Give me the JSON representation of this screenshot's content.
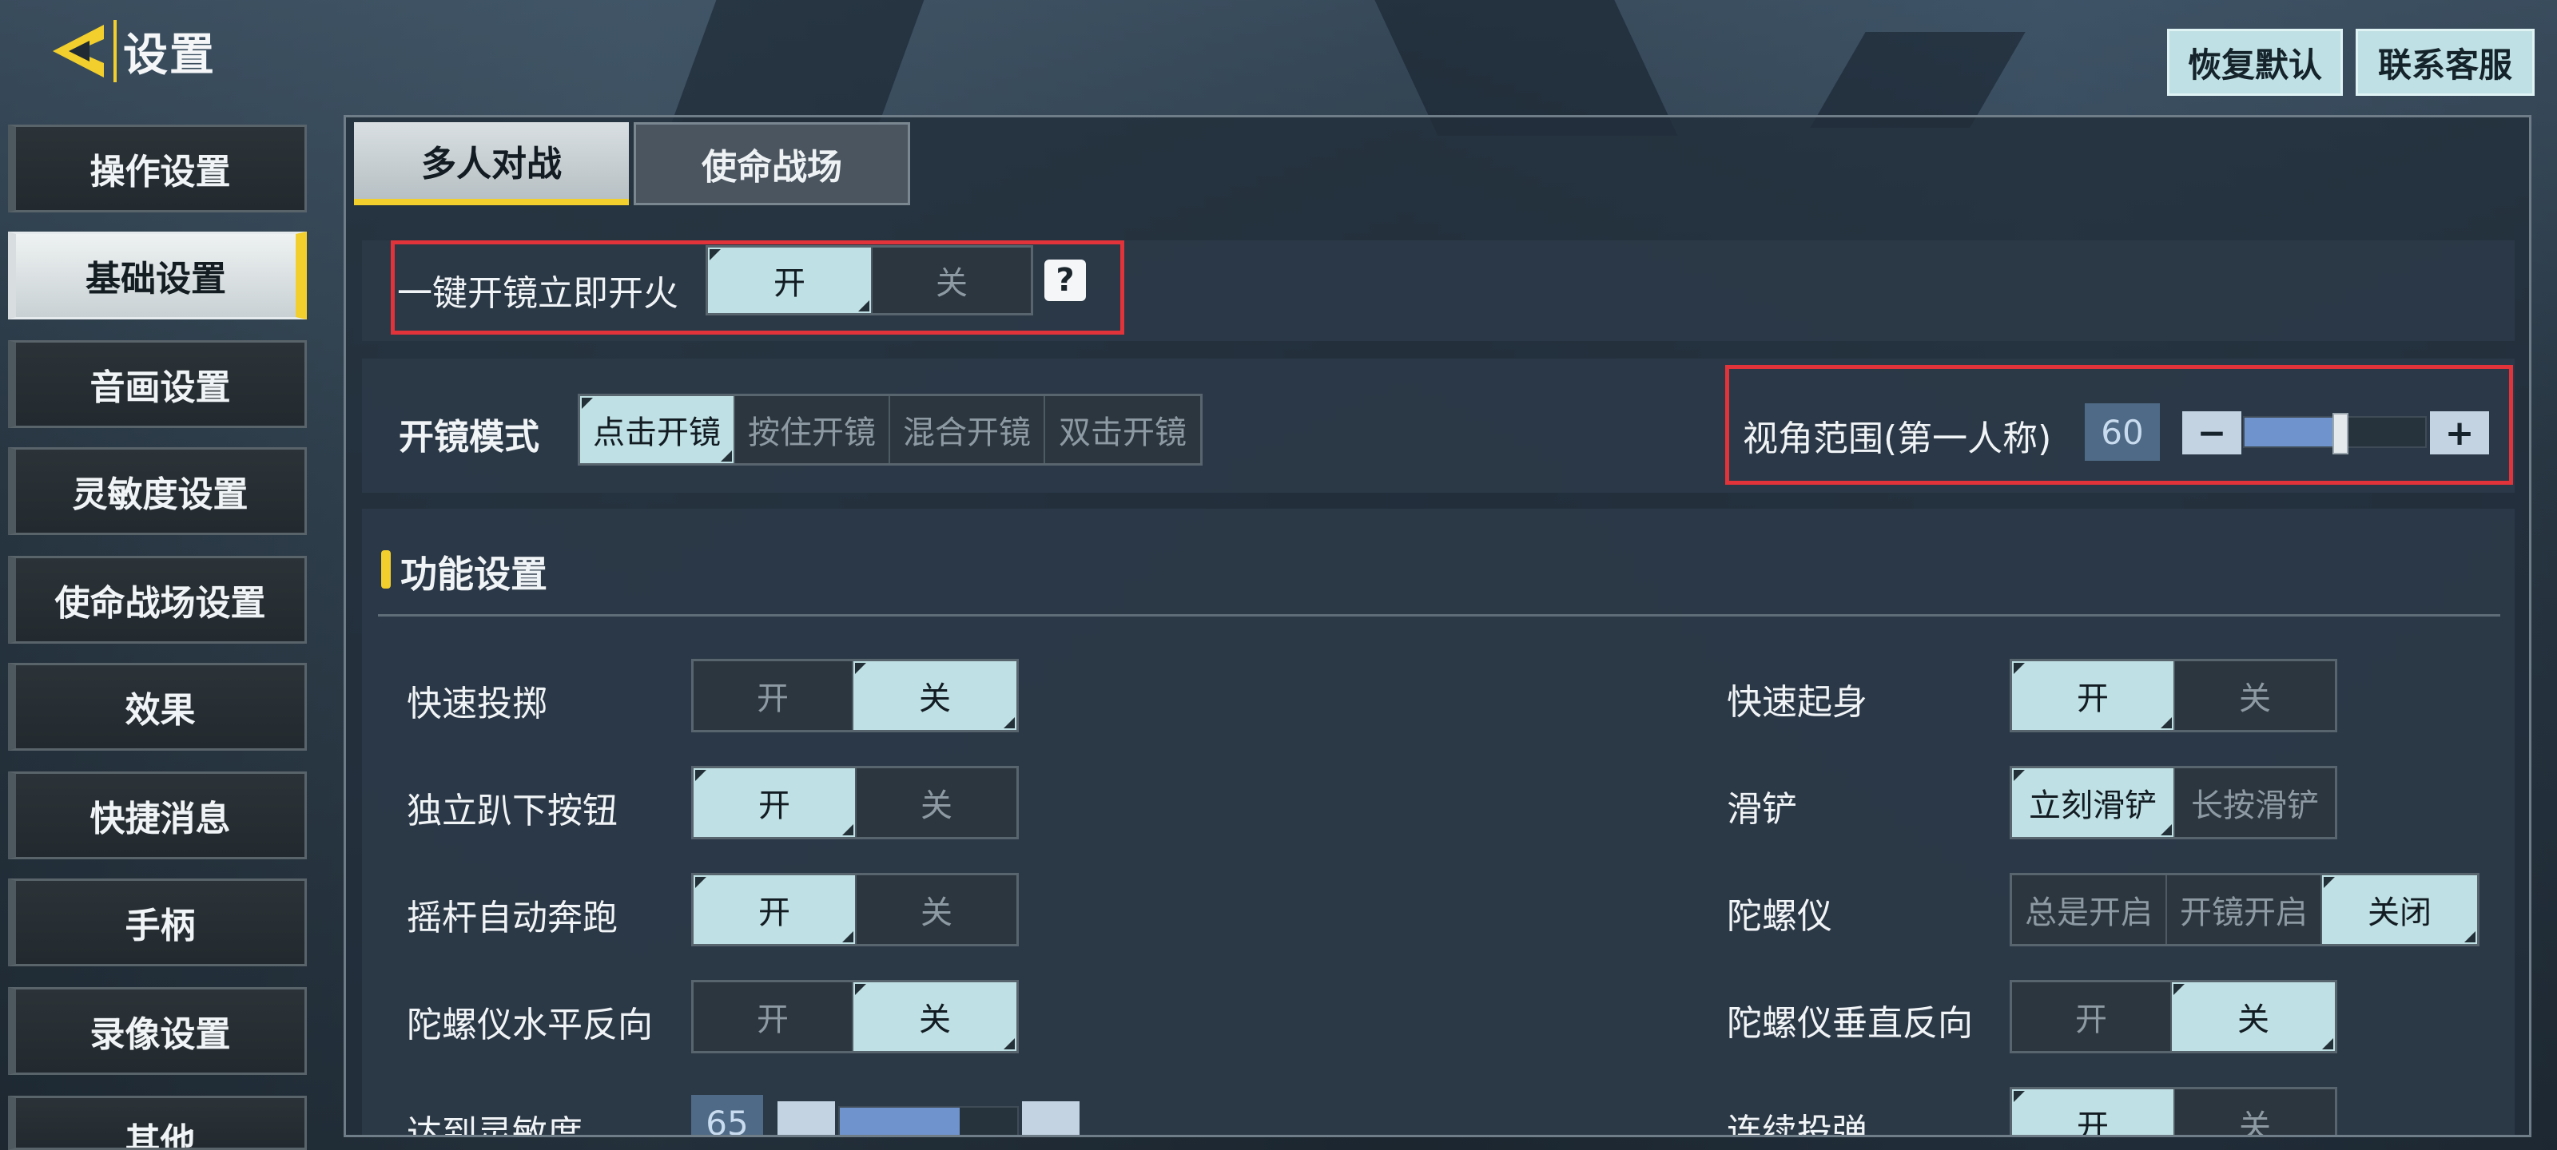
{
  "header": {
    "title": "设置",
    "restore_default": "恢复默认",
    "contact_support": "联系客服"
  },
  "sidebar": {
    "items": [
      {
        "label": "操作设置"
      },
      {
        "label": "基础设置",
        "active": true
      },
      {
        "label": "音画设置"
      },
      {
        "label": "灵敏度设置"
      },
      {
        "label": "使命战场设置"
      },
      {
        "label": "效果"
      },
      {
        "label": "快捷消息"
      },
      {
        "label": "手柄"
      },
      {
        "label": "录像设置"
      },
      {
        "label": "其他"
      }
    ]
  },
  "tabs": [
    {
      "label": "多人对战",
      "active": true
    },
    {
      "label": "使命战场",
      "active": false
    }
  ],
  "quick_scope_fire": {
    "label": "一键开镜立即开火",
    "on_label": "开",
    "off_label": "关",
    "selected": "开",
    "help_icon": "?"
  },
  "ads_mode": {
    "label": "开镜模式",
    "options": [
      "点击开镜",
      "按住开镜",
      "混合开镜",
      "双击开镜"
    ],
    "selected": "点击开镜"
  },
  "fov": {
    "label": "视角范围(第一人称)",
    "value": "60",
    "minus": "−",
    "plus": "+",
    "fill_fraction": 0.53
  },
  "functions": {
    "section_title": "功能设置",
    "left": [
      {
        "label": "快速投掷",
        "options": [
          "开",
          "关"
        ],
        "selected": "关"
      },
      {
        "label": "独立趴下按钮",
        "options": [
          "开",
          "关"
        ],
        "selected": "开"
      },
      {
        "label": "摇杆自动奔跑",
        "options": [
          "开",
          "关"
        ],
        "selected": "开"
      },
      {
        "label": "陀螺仪水平反向",
        "options": [
          "开",
          "关"
        ],
        "selected": "关"
      },
      {
        "label": "达到灵敏度",
        "value": "65"
      }
    ],
    "right": [
      {
        "label": "快速起身",
        "options": [
          "开",
          "关"
        ],
        "selected": "开"
      },
      {
        "label": "滑铲",
        "options": [
          "立刻滑铲",
          "长按滑铲"
        ],
        "selected": "立刻滑铲"
      },
      {
        "label": "陀螺仪",
        "options": [
          "总是开启",
          "开镜开启",
          "关闭"
        ],
        "selected": "关闭"
      },
      {
        "label": "陀螺仪垂直反向",
        "options": [
          "开",
          "关"
        ],
        "selected": "关"
      },
      {
        "label": "连续投弹",
        "options": [
          "开",
          "关"
        ],
        "selected": "开"
      }
    ]
  },
  "colors": {
    "accent_yellow": "#f2cf2c",
    "toggle_on": "#bfe0e4",
    "highlight_red": "#e2333a"
  },
  "icons": {
    "back": "back-chevron-icon",
    "help": "help-icon"
  }
}
